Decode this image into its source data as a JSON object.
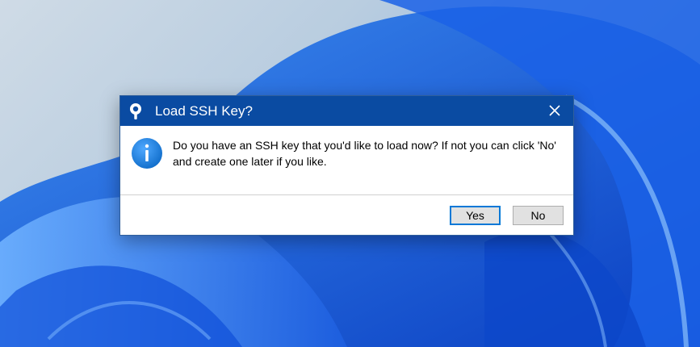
{
  "dialog": {
    "title": "Load SSH Key?",
    "message": "Do you have an SSH key that you'd like to load now? If not you can click 'No' and create one later if you like.",
    "yes_label": "Yes",
    "no_label": "No",
    "app_icon": "sourcetree-icon",
    "info_icon": "info-icon",
    "close_icon": "close-icon"
  },
  "colors": {
    "titlebar": "#0a4ba2",
    "default_button_border": "#0078d7",
    "info_icon": "#1a7fd6"
  }
}
